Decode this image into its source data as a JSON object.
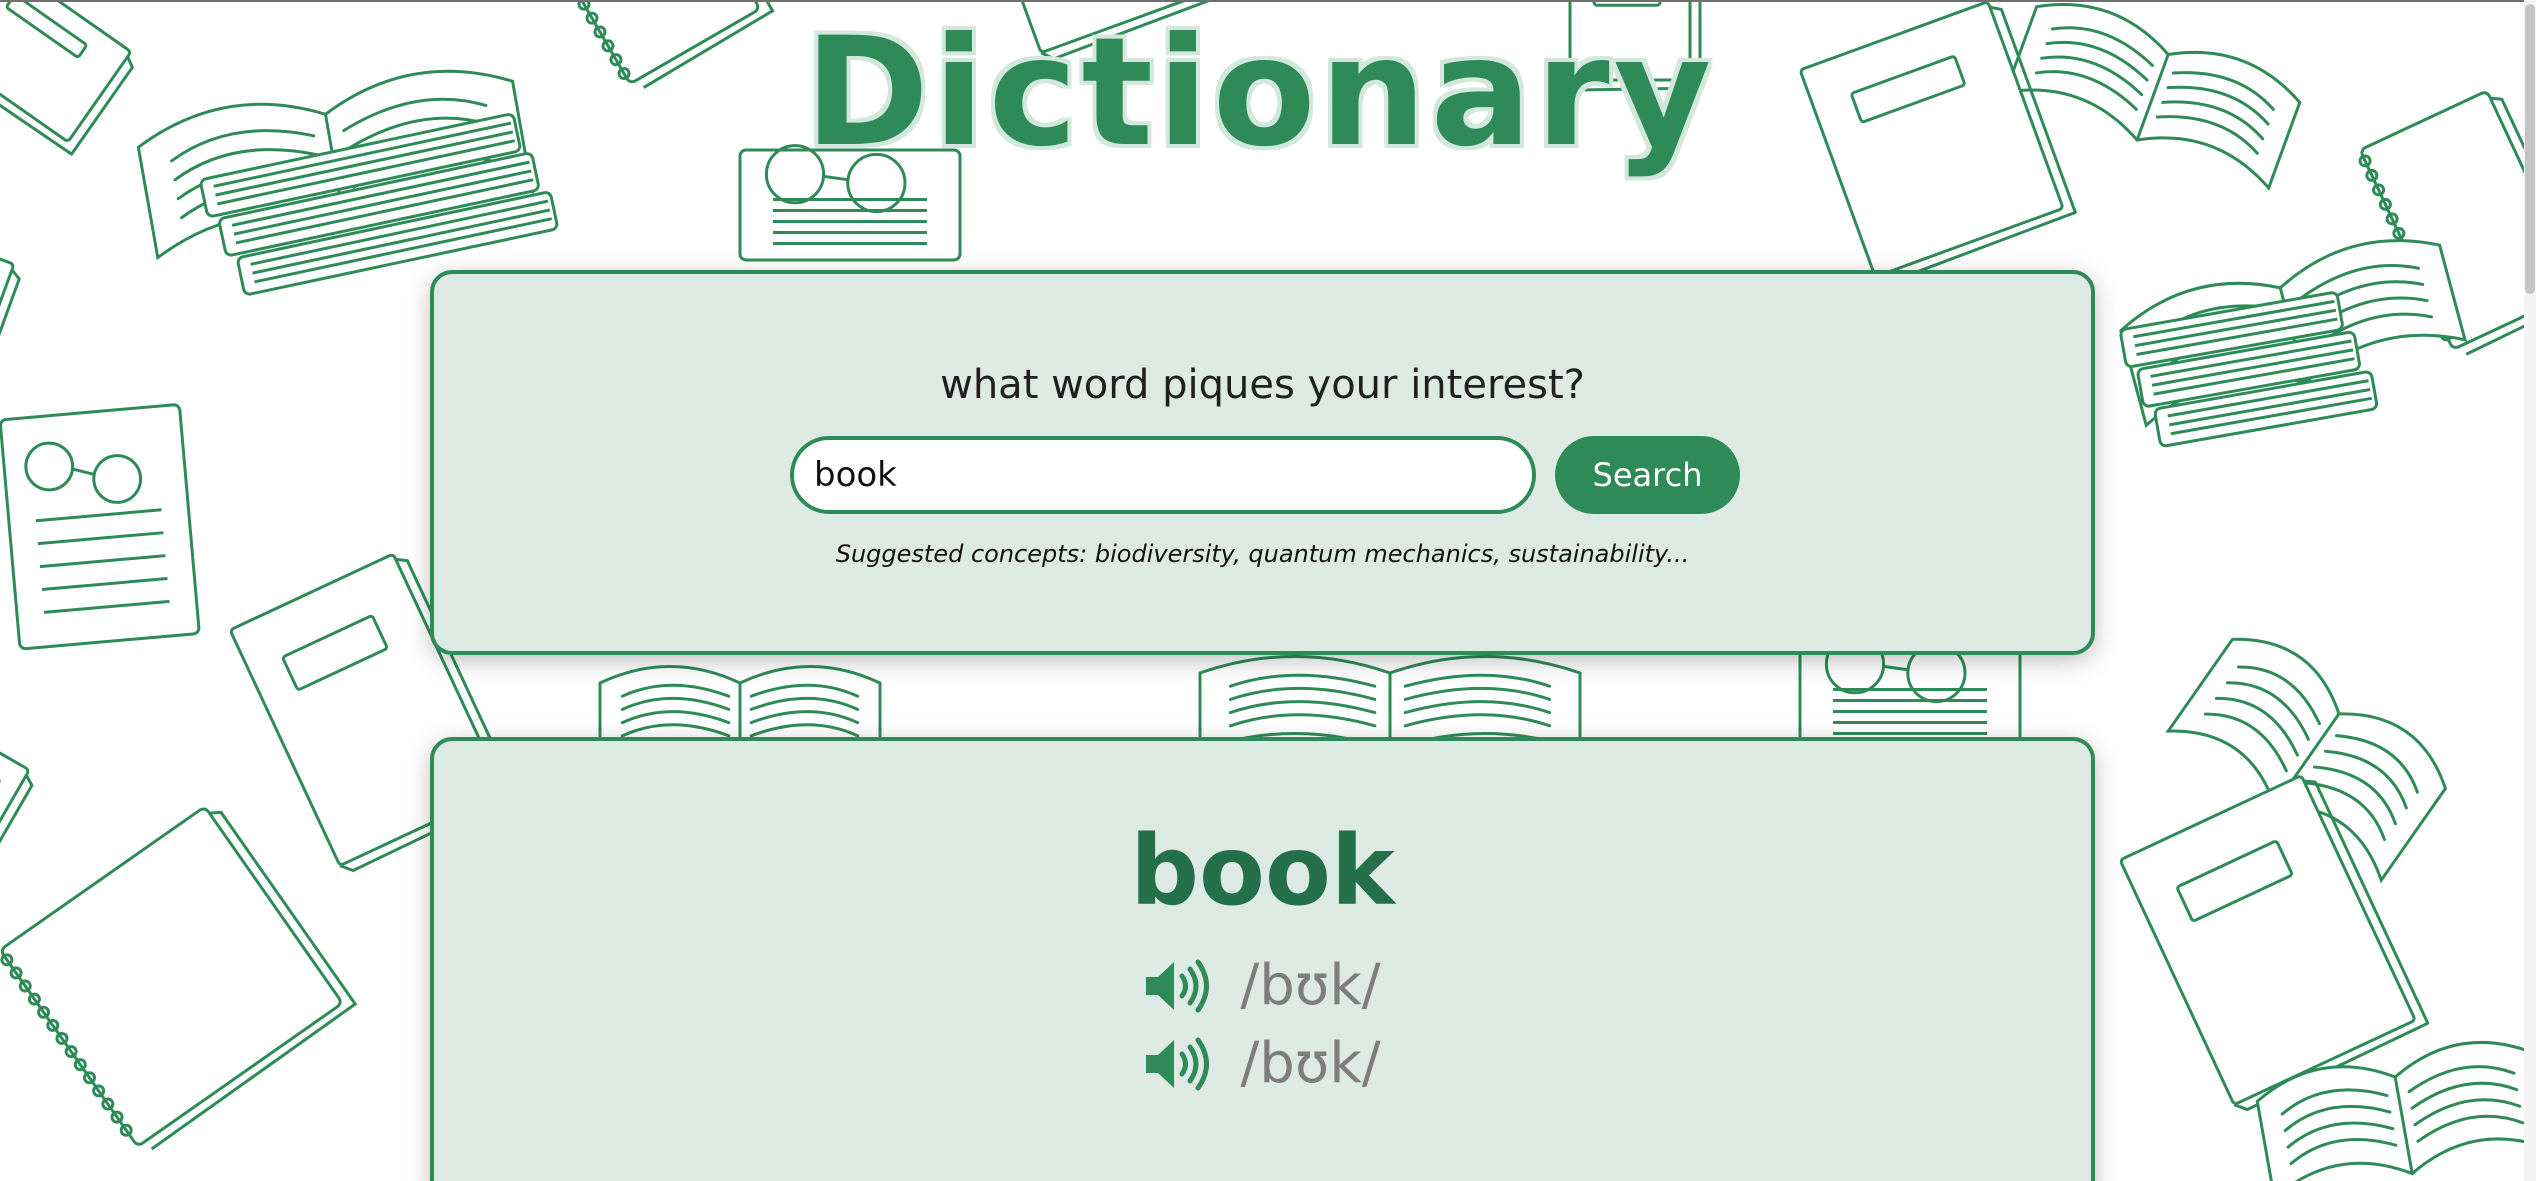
{
  "app": {
    "title": "Dictionary",
    "accent_color": "#2e8b57",
    "card_background": "#dde9e3",
    "background_pattern": "hand-drawn green book doodles"
  },
  "search": {
    "prompt": "what word piques your interest?",
    "input_value": "book",
    "input_placeholder": "",
    "button_label": "Search",
    "suggestions": "Suggested concepts: biodiversity, quantum mechanics, sustainability..."
  },
  "result": {
    "word": "book",
    "phonetics": [
      {
        "text": "/bʊk/",
        "icon": "speaker-icon"
      },
      {
        "text": "/bʊk/",
        "icon": "speaker-icon"
      }
    ]
  }
}
